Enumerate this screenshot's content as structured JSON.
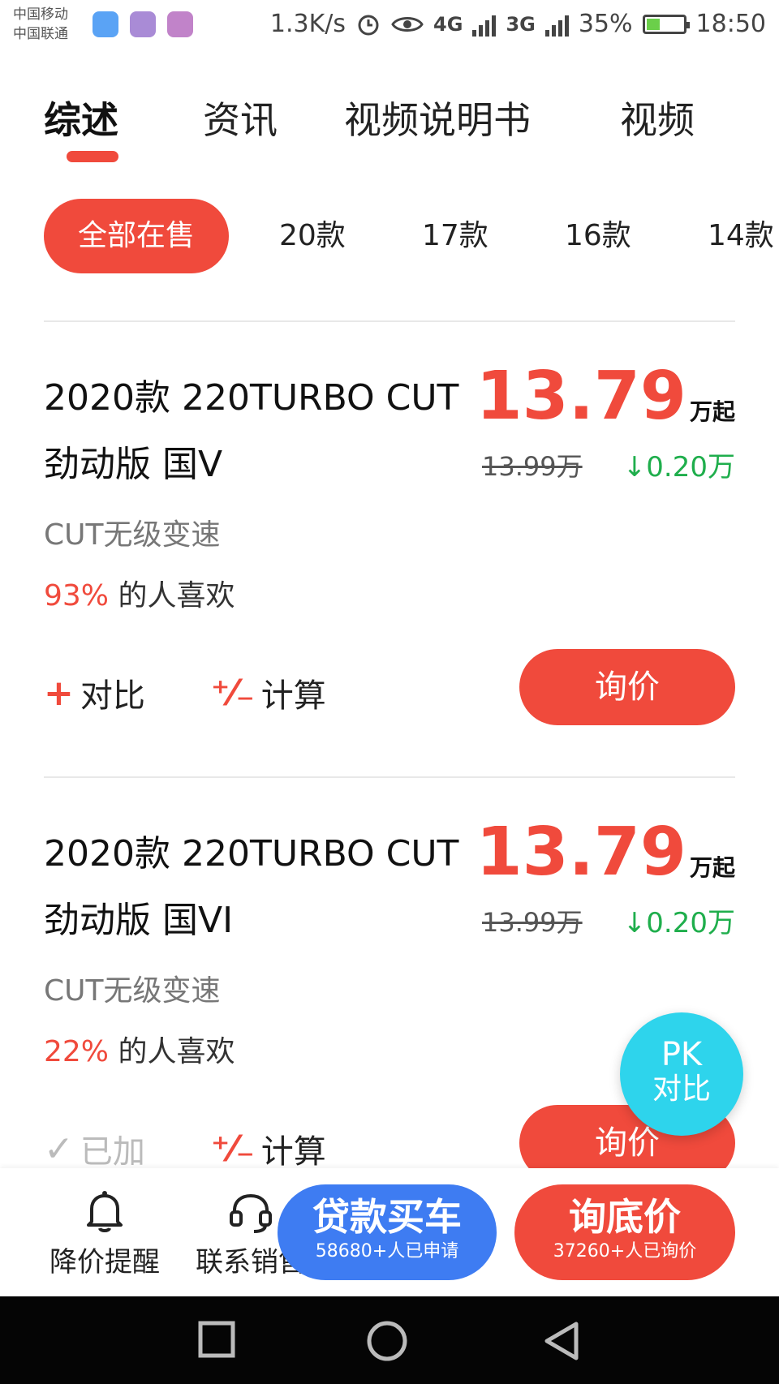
{
  "status_bar": {
    "carrier_1": "中国移动",
    "carrier_2": "中国联通",
    "net_speed": "1.3K/s",
    "network_1": "4G",
    "network_2": "3G",
    "battery": "35%",
    "time": "18:50"
  },
  "tabs": [
    {
      "label": "综述",
      "active": true
    },
    {
      "label": "资讯"
    },
    {
      "label": "视频说明书"
    },
    {
      "label": "视频"
    }
  ],
  "year_filters": [
    {
      "label": "全部在售",
      "active": true
    },
    {
      "label": "20款"
    },
    {
      "label": "17款"
    },
    {
      "label": "16款"
    },
    {
      "label": "14款"
    }
  ],
  "cars": [
    {
      "name": "2020款 220TURBO CUT 劲动版 国V",
      "price": "13.79",
      "price_unit": "万起",
      "old_price": "13.99万",
      "drop": "↓0.20万",
      "transmission": "CUT无级变速",
      "like_pct": "93%",
      "like_text": "的人喜欢",
      "compare_icon": "+",
      "compare_label": "对比",
      "calc_icon": "⁺⁄₋",
      "calc_label": "计算",
      "inquiry": "询价"
    },
    {
      "name": "2020款 220TURBO CUT 劲动版 国VI",
      "price": "13.79",
      "price_unit": "万起",
      "old_price": "13.99万",
      "drop": "↓0.20万",
      "transmission": "CUT无级变速",
      "like_pct": "22%",
      "like_text": "的人喜欢",
      "compare_icon": "✓",
      "compare_label": "已加",
      "calc_icon": "⁺⁄₋",
      "calc_label": "计算",
      "inquiry": "询价"
    }
  ],
  "pk_button": {
    "line1": "PK",
    "line2": "对比"
  },
  "bottom_bar": {
    "price_alert": "降价提醒",
    "contact_sales": "联系销售",
    "loan_title": "贷款买车",
    "loan_sub": "58680+人已申请",
    "lowest_title": "询底价",
    "lowest_sub": "37260+人已询价"
  },
  "colors": {
    "accent": "#f04a3c",
    "price_drop": "#1fae4c",
    "pk": "#2ed4ec",
    "loan": "#3e7cf2"
  }
}
